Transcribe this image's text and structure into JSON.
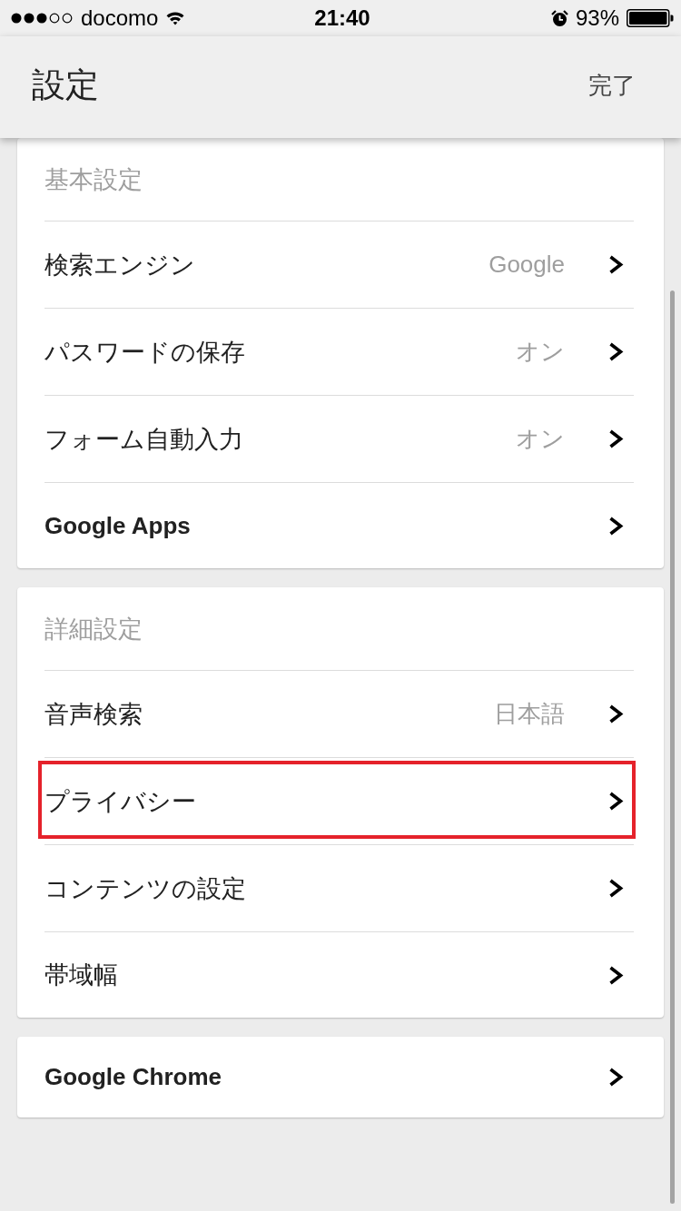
{
  "status_bar": {
    "carrier": "docomo",
    "time": "21:40",
    "battery": "93%"
  },
  "header": {
    "title": "設定",
    "done": "完了"
  },
  "sections": [
    {
      "title": "基本設定",
      "items": [
        {
          "label": "検索エンジン",
          "value": "Google",
          "emphasized": false,
          "highlighted": false
        },
        {
          "label": "パスワードの保存",
          "value": "オン",
          "emphasized": false,
          "highlighted": false
        },
        {
          "label": "フォーム自動入力",
          "value": "オン",
          "emphasized": false,
          "highlighted": false
        },
        {
          "label": "Google Apps",
          "emphasized": true,
          "highlighted": false
        }
      ]
    },
    {
      "title": "詳細設定",
      "items": [
        {
          "label": "音声検索",
          "value": "日本語",
          "emphasized": false,
          "highlighted": false
        },
        {
          "label": "プライバシー",
          "emphasized": false,
          "highlighted": true
        },
        {
          "label": "コンテンツの設定",
          "emphasized": false,
          "highlighted": false
        },
        {
          "label": "帯域幅",
          "emphasized": false,
          "highlighted": false
        }
      ]
    },
    {
      "items": [
        {
          "label": "Google Chrome",
          "emphasized": true,
          "highlighted": false
        }
      ]
    }
  ]
}
